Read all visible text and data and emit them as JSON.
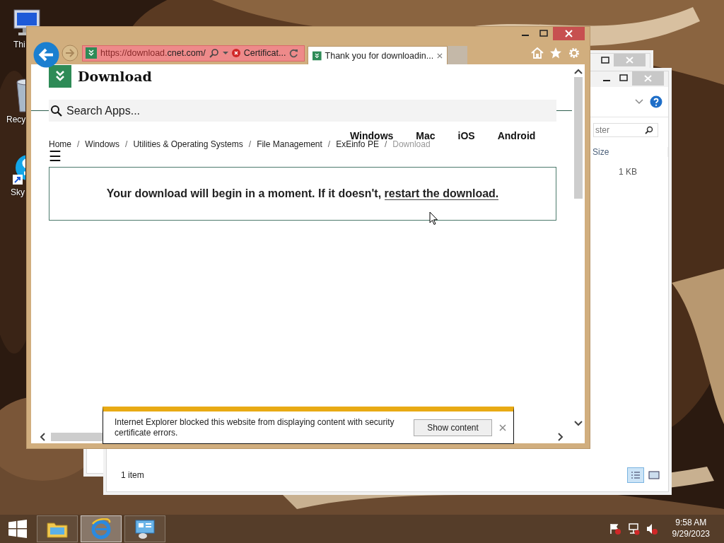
{
  "desktop_icons": [
    {
      "kind": "computer",
      "label": "Thi"
    },
    {
      "kind": "recycle",
      "label": "Recy"
    },
    {
      "kind": "skype",
      "label": "Sky"
    }
  ],
  "explorer": {
    "search": {
      "placeholder": "ster"
    },
    "columns": [
      "Size"
    ],
    "rows": [
      {
        "size": "1 KB"
      }
    ],
    "status_bar": "1 item",
    "views": [
      {
        "kind": "details",
        "selected": true
      },
      {
        "kind": "thumbnails",
        "selected": false
      }
    ]
  },
  "browser": {
    "address_bar": {
      "url_scheme": "https://download.",
      "url_host": "cnet.com/",
      "certificate": "Certificat..."
    },
    "tabs": [
      {
        "title": "Thank you for downloadin...",
        "selected": true
      }
    ],
    "page": {
      "logo": "Download",
      "search": {
        "placeholder": "Search Apps..."
      },
      "breadcrumb": [
        {
          "label": "Home",
          "current": false
        },
        {
          "separator": "/",
          "label": "Windows",
          "current": false
        },
        {
          "separator": "/",
          "label": "Utilities & Operating Systems",
          "current": false
        },
        {
          "separator": "/",
          "label": "File Management",
          "current": false
        },
        {
          "separator": "/",
          "label": "ExEinfo PE",
          "current": false
        },
        {
          "separator": "/",
          "label": "Download",
          "current": true
        }
      ],
      "nav": [
        "Windows",
        "Mac",
        "iOS",
        "Android"
      ],
      "menu": "☰",
      "message": "Your download will begin in a moment. If it doesn't,",
      "link": "restart the download."
    }
  },
  "notification": {
    "text": "Internet Explorer blocked this website from displaying content with security certificate errors.",
    "button": "Show content"
  },
  "taskbar": {
    "apps": [
      {
        "kind": "explorer",
        "selected": false
      },
      {
        "kind": "ie",
        "selected": true
      },
      {
        "kind": "control_panel",
        "selected": false
      }
    ],
    "time": "9:58 AM",
    "date": "9/29/2023"
  }
}
